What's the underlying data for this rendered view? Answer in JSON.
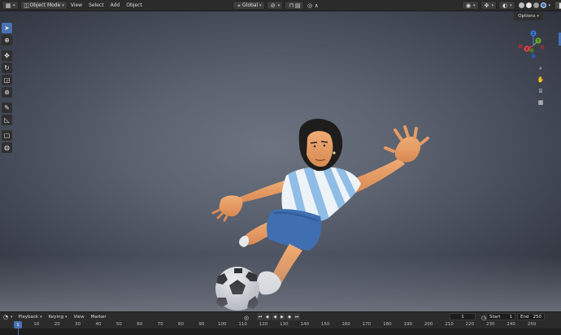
{
  "header": {
    "mode_label": "Object Mode",
    "menus": [
      "View",
      "Select",
      "Add",
      "Object"
    ],
    "transform_orientation": "Global"
  },
  "viewport": {
    "options_label": "Options"
  },
  "gizmo": {
    "axes": {
      "x": "X",
      "y": "Y",
      "z": "Z"
    },
    "colors": {
      "x": "#e2404b",
      "y": "#6ca626",
      "z": "#3a79d8"
    }
  },
  "timeline": {
    "menus": [
      "Playback",
      "Keying",
      "View",
      "Marker"
    ],
    "current_frame": "1",
    "start_label": "Start",
    "start_value": "1",
    "end_label": "End",
    "end_value": "250",
    "ruler_ticks": [
      "1",
      "10",
      "20",
      "30",
      "40",
      "50",
      "60",
      "70",
      "80",
      "90",
      "100",
      "110",
      "120",
      "130",
      "140",
      "150",
      "160",
      "170",
      "180",
      "190",
      "200",
      "210",
      "220",
      "230",
      "240",
      "250"
    ]
  },
  "colors": {
    "accent": "#4772b3",
    "shirt_light": "#8fbde6",
    "shorts": "#3f6fb0",
    "skin": "#e59a64"
  }
}
